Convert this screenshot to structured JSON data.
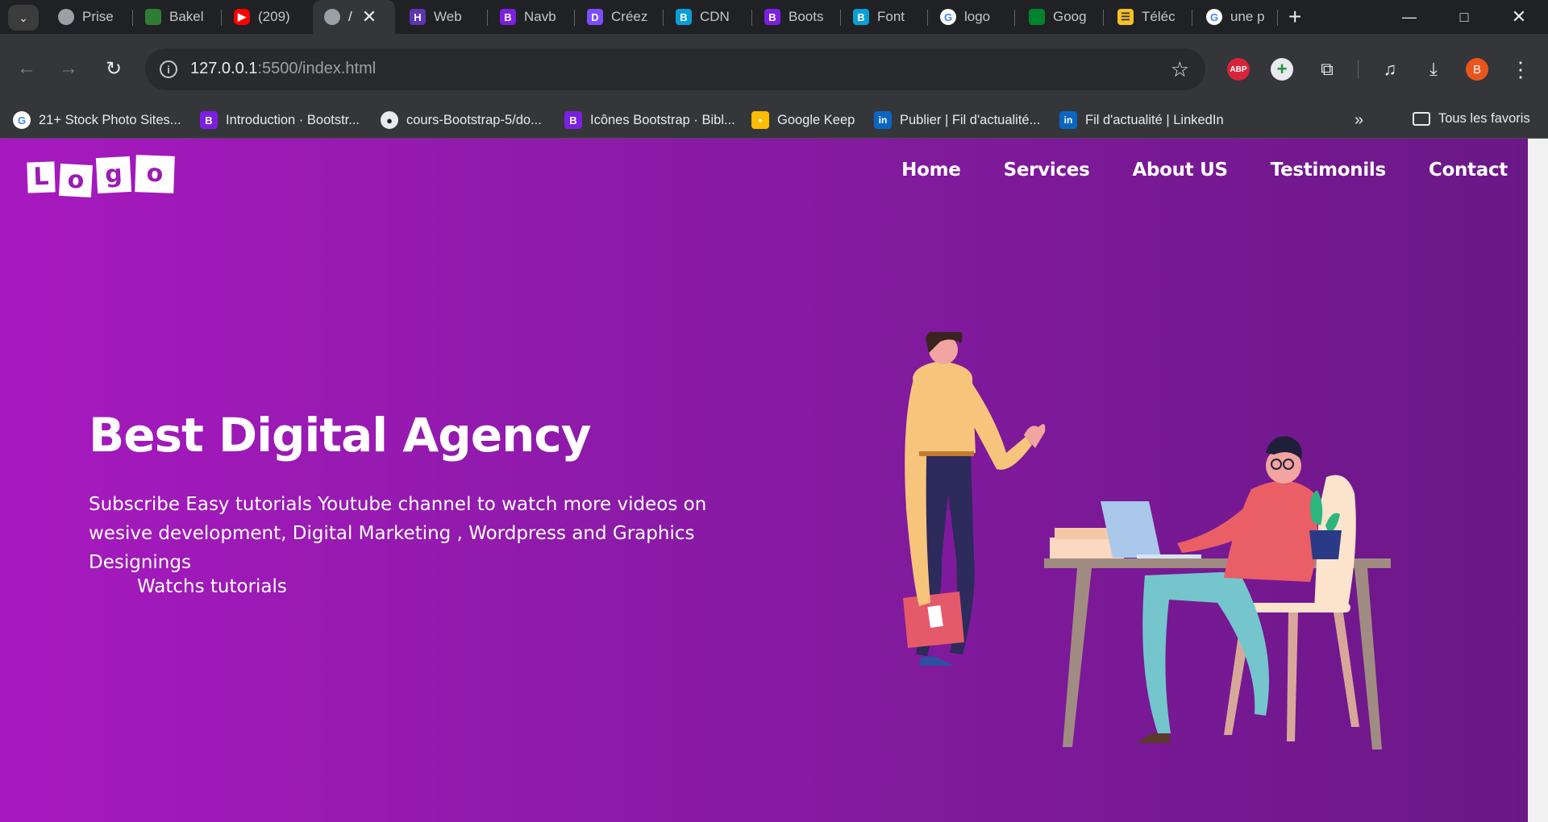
{
  "browser": {
    "tabs": [
      {
        "title": "Prise",
        "icon": "globe-icon"
      },
      {
        "title": "Bakel",
        "icon": "bakeli-icon"
      },
      {
        "title": "(209)",
        "icon": "youtube-icon"
      },
      {
        "title": "/",
        "icon": "globe-icon",
        "active": true
      },
      {
        "title": "Web",
        "icon": "h-logo-icon"
      },
      {
        "title": "Navb",
        "icon": "bootstrap-icon"
      },
      {
        "title": "Créez",
        "icon": "canva-icon"
      },
      {
        "title": "CDN",
        "icon": "bootstrap-blue-icon"
      },
      {
        "title": "Boots",
        "icon": "bootstrap-icon"
      },
      {
        "title": "Font",
        "icon": "bootstrap-blue-icon"
      },
      {
        "title": "logo",
        "icon": "google-icon"
      },
      {
        "title": "Goog",
        "icon": "google-meet-icon"
      },
      {
        "title": "Téléc",
        "icon": "layers-icon"
      },
      {
        "title": "une p",
        "icon": "google-icon"
      }
    ],
    "url_host": "127.0.0.1",
    "url_path": ":5500/index.html",
    "avatar_letter": "B",
    "abp_label": "ABP",
    "bookmarks": [
      {
        "title": "21+ Stock Photo Sites...",
        "icon": "google-icon"
      },
      {
        "title": "Introduction · Bootstr...",
        "icon": "bootstrap-icon"
      },
      {
        "title": "cours-Bootstrap-5/do...",
        "icon": "github-icon"
      },
      {
        "title": "Icônes Bootstrap · Bibl...",
        "icon": "bootstrap-icon"
      },
      {
        "title": "Google Keep",
        "icon": "keep-icon"
      },
      {
        "title": "Publier | Fil d'actualité...",
        "icon": "linkedin-icon"
      },
      {
        "title": "Fil d'actualité | LinkedIn",
        "icon": "linkedin-icon"
      }
    ],
    "all_bookmarks": "Tous les favoris"
  },
  "site": {
    "logo_letters": [
      "L",
      "o",
      "g",
      "o"
    ],
    "nav": [
      "Home",
      "Services",
      "About US",
      "Testimonils",
      "Contact"
    ],
    "hero_title": "Best Digital Agency",
    "hero_text": "Subscribe Easy tutorials Youtube channel to watch more videos on wesive development, Digital Marketing , Wordpress and Graphics Designings",
    "hero_button": "Watchs tutorials"
  },
  "colors": {
    "gradient_start": "#a719bf",
    "gradient_end": "#6b1887",
    "browser_bg": "#202124",
    "toolbar_bg": "#35363a"
  }
}
